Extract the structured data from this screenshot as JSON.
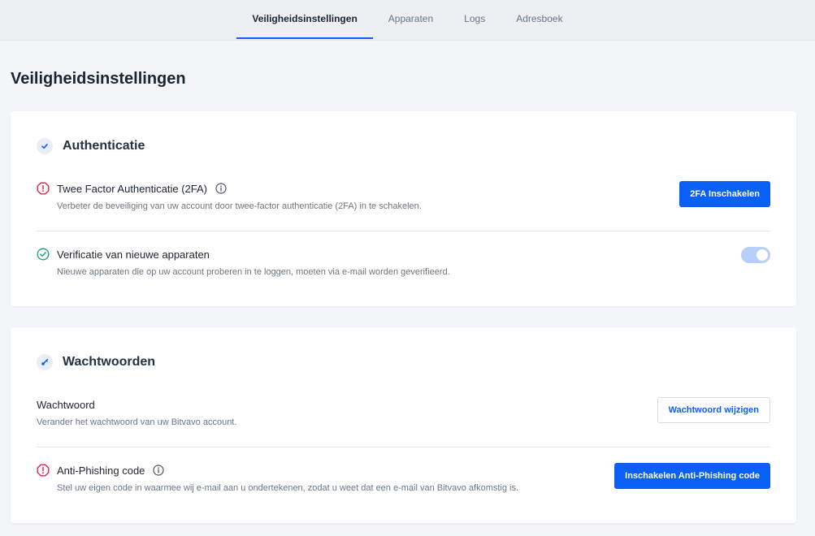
{
  "nav": {
    "tabs": [
      {
        "label": "Veiligheidsinstellingen",
        "active": true
      },
      {
        "label": "Apparaten",
        "active": false
      },
      {
        "label": "Logs",
        "active": false
      },
      {
        "label": "Adresboek",
        "active": false
      }
    ]
  },
  "page": {
    "title": "Veiligheidsinstellingen"
  },
  "authentication": {
    "title": "Authenticatie",
    "icon": "check-icon",
    "items": [
      {
        "title": "Twee Factor Authenticatie (2FA)",
        "description": "Verbeter de beveiliging van uw account door twee-factor authenticatie (2FA) in te schakelen.",
        "status": "warning",
        "button_label": "2FA Inschakelen"
      },
      {
        "title": "Verificatie van nieuwe apparaten",
        "description": "Nieuwe apparaten die op uw account proberen in te loggen, moeten via e-mail worden geverifieerd.",
        "status": "ok",
        "toggle_on": true
      }
    ]
  },
  "passwords": {
    "title": "Wachtwoorden",
    "icon": "key-icon",
    "items": [
      {
        "title": "Wachtwoord",
        "description": "Verander het wachtwoord van uw Bitvavo account.",
        "button_label": "Wachtwoord wijzigen"
      },
      {
        "title": "Anti-Phishing code",
        "description": "Stel uw eigen code in waarmee wij e-mail aan u ondertekenen, zodat u weet dat een e-mail van Bitvavo afkomstig is.",
        "status": "warning",
        "button_label": "Inschakelen Anti-Phishing code"
      }
    ]
  },
  "colors": {
    "primary": "#0a5ff5",
    "warning": "#e0244f",
    "success": "#1fa37b",
    "toggle_on": "#b7d0fb"
  }
}
